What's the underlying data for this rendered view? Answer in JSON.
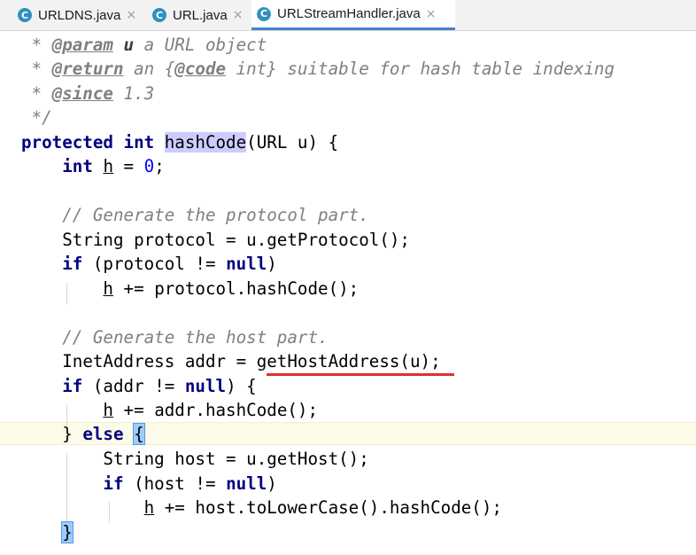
{
  "tabs": [
    {
      "label": "URLDNS.java",
      "icon": "class-icon",
      "icon_glyph": "C"
    },
    {
      "label": "URL.java",
      "icon": "class-icon",
      "icon_glyph": "C"
    },
    {
      "label": "URLStreamHandler.java",
      "icon": "abstract-class-icon",
      "icon_glyph": "C",
      "active": true
    }
  ],
  "close_glyph": "×",
  "code": {
    "l1": {
      "a": " * ",
      "b": "@param",
      "c": " ",
      "d": "u",
      "e": " a URL object"
    },
    "l2": {
      "a": " * ",
      "b": "@return",
      "c": " an {",
      "d": "@code",
      "e": " int} suitable for hash table indexing"
    },
    "l3": {
      "a": " * ",
      "b": "@since",
      "c": " 1.3"
    },
    "l4": {
      "a": " */"
    },
    "l5": {
      "kw1": "protected",
      "sp1": " ",
      "kw2": "int",
      "sp2": " ",
      "fn": "hashCode",
      "rest": "(URL u) {"
    },
    "l6": {
      "ind": "    ",
      "kw": "int",
      "sp": " ",
      "v": "h",
      "eq": " = ",
      "num": "0",
      "end": ";"
    },
    "l8": {
      "ind": "    ",
      "cm": "// Generate the protocol part."
    },
    "l9": {
      "ind": "    ",
      "t": "String protocol = u.getProtocol();"
    },
    "l10": {
      "ind": "    ",
      "kw": "if",
      "a": " (protocol != ",
      "kw2": "null",
      "b": ")"
    },
    "l11": {
      "ind": "        ",
      "v": "h",
      "t": " += protocol.hashCode();"
    },
    "l13": {
      "ind": "    ",
      "cm": "// Generate the host part."
    },
    "l14": {
      "ind": "    ",
      "t": "InetAddress addr = getHostAddress(u);"
    },
    "l15": {
      "ind": "    ",
      "kw": "if",
      "a": " (addr != ",
      "kw2": "null",
      "b": ") {"
    },
    "l16": {
      "ind": "        ",
      "v": "h",
      "t": " += addr.hashCode();"
    },
    "l17": {
      "ind": "    ",
      "a": "} ",
      "kw": "else",
      "sp": " ",
      "br": "{"
    },
    "l18": {
      "ind": "        ",
      "t": "String host = u.getHost();"
    },
    "l19": {
      "ind": "        ",
      "kw": "if",
      "a": " (host != ",
      "kw2": "null",
      "b": ")"
    },
    "l20": {
      "ind": "            ",
      "v": "h",
      "t": " += host.toLowerCase().hashCode();"
    },
    "l21": {
      "ind": "    ",
      "br": "}"
    }
  },
  "colors": {
    "keyword": "#000080",
    "number": "#0000ff",
    "comment": "#808080",
    "underline": "#e03030",
    "tab_accent": "#4083c9"
  }
}
